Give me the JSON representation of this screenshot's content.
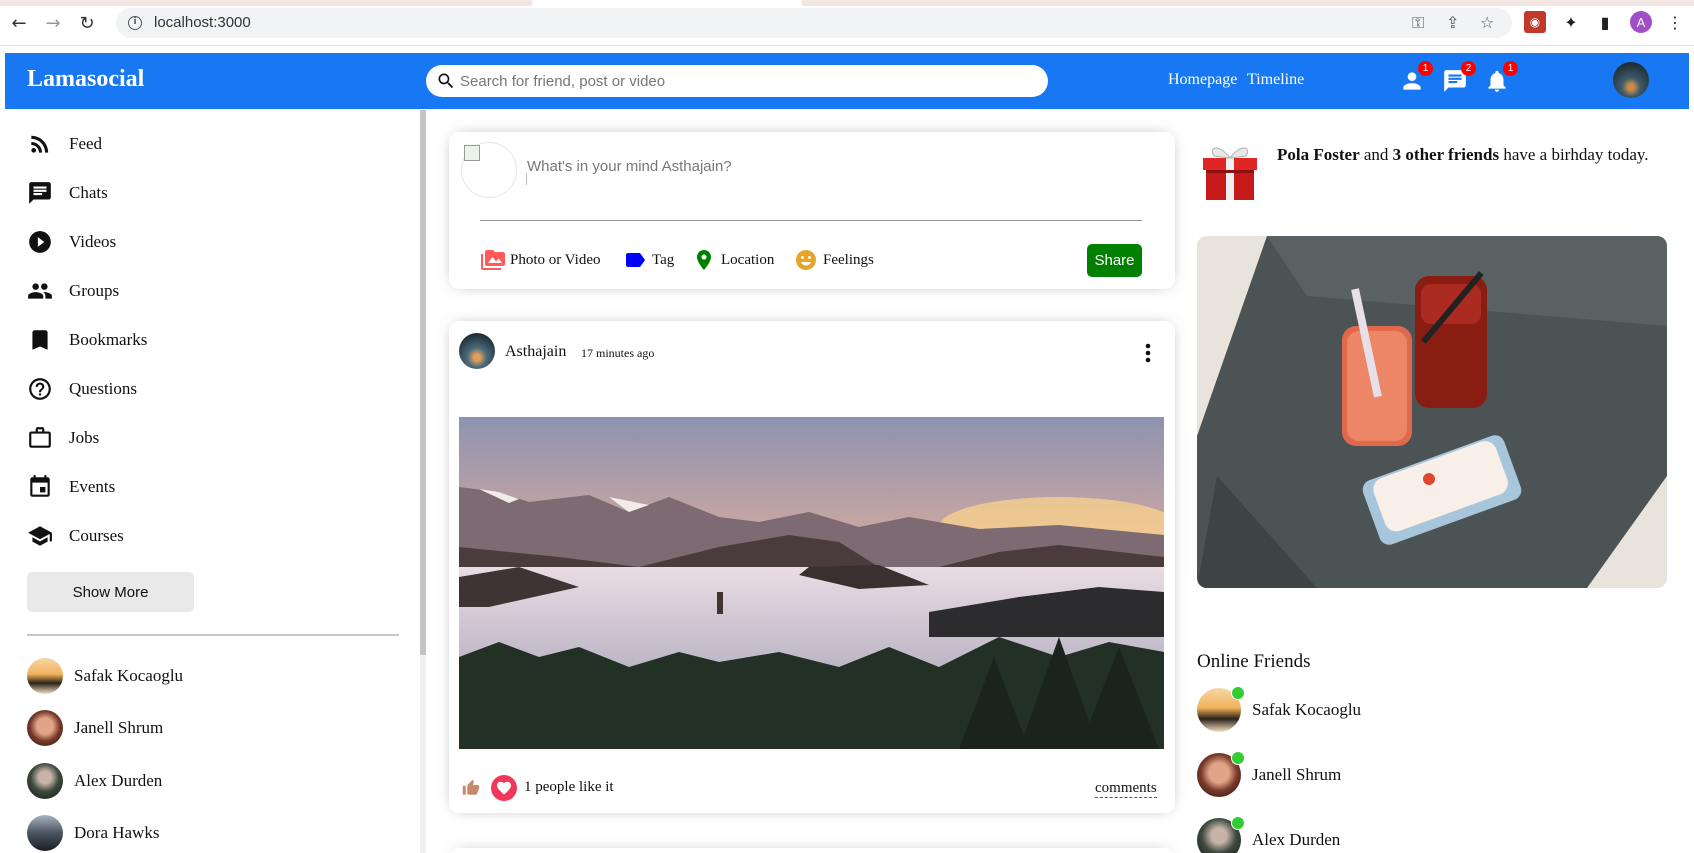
{
  "browser": {
    "url": "localhost:3000",
    "profile_initial": "A"
  },
  "topbar": {
    "logo": "Lamasocial",
    "search_placeholder": "Search for friend, post or video",
    "links": [
      "Homepage",
      "Timeline"
    ],
    "badges": {
      "friends": "1",
      "messages": "2",
      "notifications": "1"
    },
    "accent_color": "#1877f2"
  },
  "sidebar": {
    "items": [
      {
        "label": "Feed",
        "icon": "rss-feed-icon"
      },
      {
        "label": "Chats",
        "icon": "chat-icon"
      },
      {
        "label": "Videos",
        "icon": "play-circle-icon"
      },
      {
        "label": "Groups",
        "icon": "group-icon"
      },
      {
        "label": "Bookmarks",
        "icon": "bookmark-icon"
      },
      {
        "label": "Questions",
        "icon": "help-outline-icon"
      },
      {
        "label": "Jobs",
        "icon": "work-outline-icon"
      },
      {
        "label": "Events",
        "icon": "event-icon"
      },
      {
        "label": "Courses",
        "icon": "school-icon"
      }
    ],
    "show_more": "Show More",
    "friends": [
      "Safak Kocaoglu",
      "Janell Shrum",
      "Alex Durden",
      "Dora Hawks"
    ]
  },
  "share": {
    "placeholder": "What's in your mind Asthajain?",
    "options": [
      {
        "label": "Photo or Video",
        "icon": "perm-media-icon",
        "color": "#ff5b5b"
      },
      {
        "label": "Tag",
        "icon": "label-icon",
        "color": "#0000ff"
      },
      {
        "label": "Location",
        "icon": "room-icon",
        "color": "#008000"
      },
      {
        "label": "Feelings",
        "icon": "emoji-emotions-icon",
        "color": "#e6a42b"
      }
    ],
    "button": "Share"
  },
  "post": {
    "username": "Asthajain",
    "time": "17 minutes ago",
    "likes_text": "1 people like it",
    "comments": "comments"
  },
  "rightbar": {
    "birthday_name": "Pola Foster",
    "birthday_mid": " and ",
    "birthday_friends": "3 other friends",
    "birthday_rest": " have a birhday today.",
    "online_title": "Online Friends",
    "online_friends": [
      "Safak Kocaoglu",
      "Janell Shrum",
      "Alex Durden"
    ],
    "online_color": "#32cd32"
  }
}
